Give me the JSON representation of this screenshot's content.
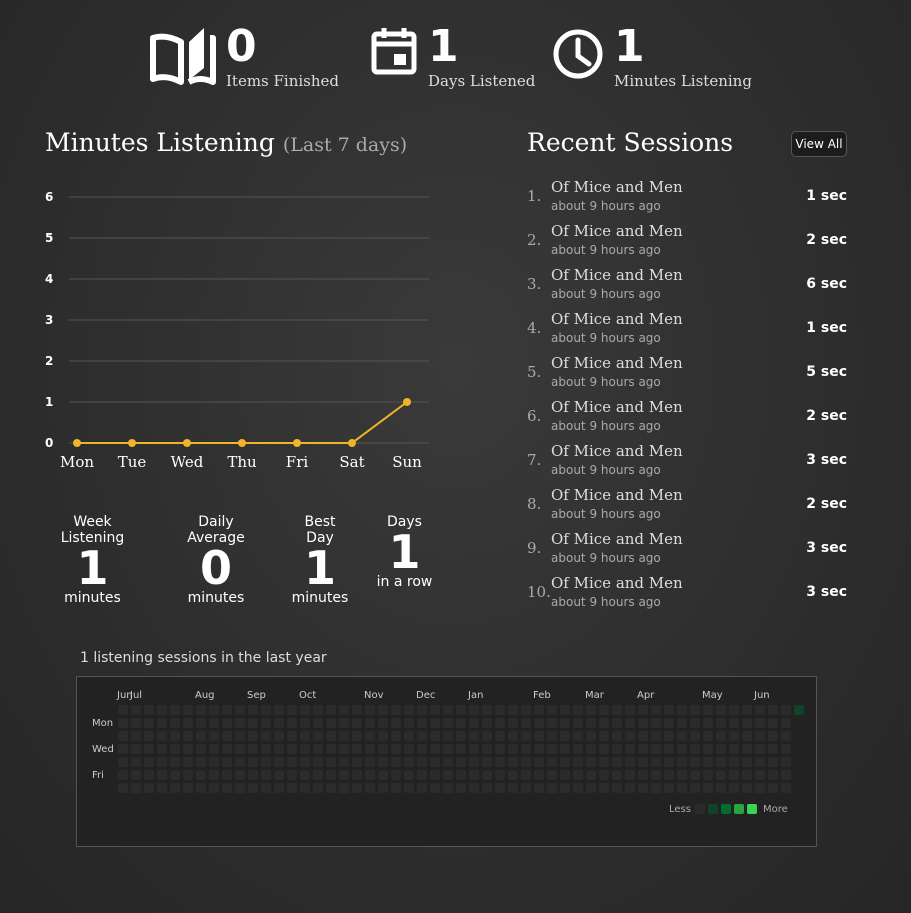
{
  "stats": {
    "items_finished": {
      "value": "0",
      "label": "Items Finished",
      "icon": "open-book-icon"
    },
    "days_listened": {
      "value": "1",
      "label": "Days Listened",
      "icon": "calendar-icon"
    },
    "minutes_listening": {
      "value": "1",
      "label": "Minutes Listening",
      "icon": "clock-icon"
    }
  },
  "chart_section": {
    "title": "Minutes Listening",
    "subtitle": "(Last 7 days)"
  },
  "chart_data": {
    "type": "line",
    "categories": [
      "Mon",
      "Tue",
      "Wed",
      "Thu",
      "Fri",
      "Sat",
      "Sun"
    ],
    "values": [
      0,
      0,
      0,
      0,
      0,
      0,
      1
    ],
    "y_ticks": [
      "0",
      "1",
      "2",
      "3",
      "4",
      "5",
      "6"
    ],
    "ylim": [
      0,
      6
    ],
    "grid": true,
    "line_color": "#f0b429"
  },
  "summary": [
    {
      "heading": "Week Listening",
      "value": "1",
      "unit": "minutes"
    },
    {
      "heading": "Daily Average",
      "value": "0",
      "unit": "minutes"
    },
    {
      "heading": "Best Day",
      "value": "1",
      "unit": "minutes"
    },
    {
      "heading": "Days",
      "value": "1",
      "unit": "in a row"
    }
  ],
  "sessions_section": {
    "title": "Recent Sessions",
    "view_all_label": "View All",
    "items": [
      {
        "index": "1.",
        "title": "Of Mice and Men",
        "ago": "about 9 hours ago",
        "duration": "1 sec"
      },
      {
        "index": "2.",
        "title": "Of Mice and Men",
        "ago": "about 9 hours ago",
        "duration": "2 sec"
      },
      {
        "index": "3.",
        "title": "Of Mice and Men",
        "ago": "about 9 hours ago",
        "duration": "6 sec"
      },
      {
        "index": "4.",
        "title": "Of Mice and Men",
        "ago": "about 9 hours ago",
        "duration": "1 sec"
      },
      {
        "index": "5.",
        "title": "Of Mice and Men",
        "ago": "about 9 hours ago",
        "duration": "5 sec"
      },
      {
        "index": "6.",
        "title": "Of Mice and Men",
        "ago": "about 9 hours ago",
        "duration": "2 sec"
      },
      {
        "index": "7.",
        "title": "Of Mice and Men",
        "ago": "about 9 hours ago",
        "duration": "3 sec"
      },
      {
        "index": "8.",
        "title": "Of Mice and Men",
        "ago": "about 9 hours ago",
        "duration": "2 sec"
      },
      {
        "index": "9.",
        "title": "Of Mice and Men",
        "ago": "about 9 hours ago",
        "duration": "3 sec"
      },
      {
        "index": "10.",
        "title": "Of Mice and Men",
        "ago": "about 9 hours ago",
        "duration": "3 sec"
      }
    ]
  },
  "year": {
    "caption": "1 listening sessions in the last year",
    "months": [
      "Jun",
      "Jul",
      "Aug",
      "Sep",
      "Oct",
      "Nov",
      "Dec",
      "Jan",
      "Feb",
      "Mar",
      "Apr",
      "May",
      "Jun"
    ],
    "day_labels": [
      "Mon",
      "Wed",
      "Fri"
    ],
    "legend_less": "Less",
    "legend_more": "More",
    "legend_colors": [
      "#2b2b2b",
      "#0e4429",
      "#006d32",
      "#26a641",
      "#39d353"
    ],
    "empty_color": "#2b2b2b",
    "active_color": "#0e4429"
  }
}
